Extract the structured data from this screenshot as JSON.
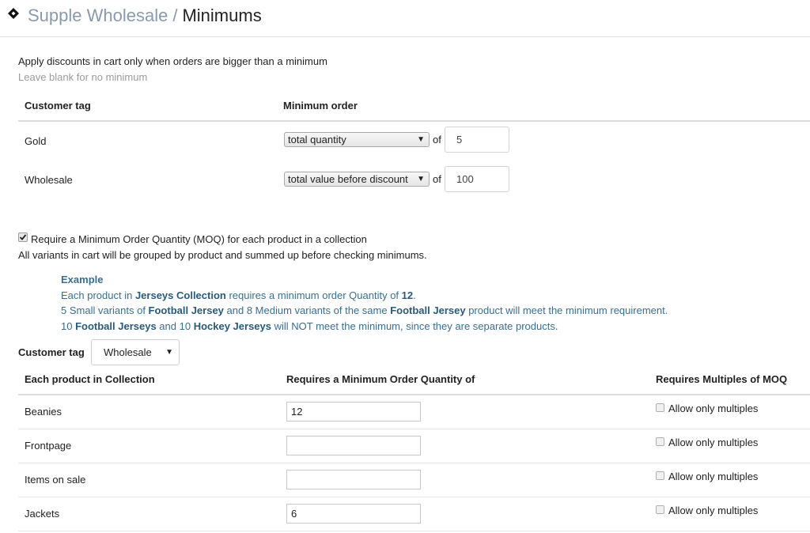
{
  "header": {
    "app_name": "Supple Wholesale",
    "separator": "/",
    "page_title": "Minimums"
  },
  "intro": {
    "line1": "Apply discounts in cart only when orders are bigger than a minimum",
    "line2": "Leave blank for no minimum"
  },
  "minimums_table": {
    "col_tag": "Customer tag",
    "col_min": "Minimum order",
    "of_label": "of",
    "rows": [
      {
        "tag": "Gold",
        "type": "total quantity",
        "value": "5"
      },
      {
        "tag": "Wholesale",
        "type": "total value before discount",
        "value": "100"
      }
    ]
  },
  "moq": {
    "checkbox_label": "Require a Minimum Order Quantity (MOQ) for each product in a collection",
    "checked": true,
    "note": "All variants in cart will be grouped by product and summed up before checking minimums."
  },
  "example": {
    "title": "Example",
    "l1a": "Each product in ",
    "l1b": "Jerseys Collection",
    "l1c": " requires a minimum order Quantity of ",
    "l1d": "12",
    "l1e": ".",
    "l2a": "5 Small variants of ",
    "l2b": "Football Jersey",
    "l2c": " and 8 Medium variants of the same ",
    "l2d": "Football Jersey",
    "l2e": " product will meet the minimum requirement.",
    "l3a": "10 ",
    "l3b": "Football Jerseys",
    "l3c": " and 10 ",
    "l3d": "Hockey Jerseys",
    "l3e": " will NOT meet the minimum, since they are separate products."
  },
  "customer_tag": {
    "label": "Customer tag",
    "selected": "Wholesale"
  },
  "collections_table": {
    "col_collection": "Each product in Collection",
    "col_moq": "Requires a Minimum Order Quantity of",
    "col_multiples": "Requires Multiples of MOQ",
    "multiples_label": "Allow only multiples",
    "rows": [
      {
        "name": "Beanies",
        "moq": "12"
      },
      {
        "name": "Frontpage",
        "moq": ""
      },
      {
        "name": "Items on sale",
        "moq": ""
      },
      {
        "name": "Jackets",
        "moq": "6"
      }
    ]
  },
  "icons": {
    "logo": "diamond-move-icon",
    "dropdown": "triangle-down-icon",
    "check": "checkmark-icon"
  }
}
